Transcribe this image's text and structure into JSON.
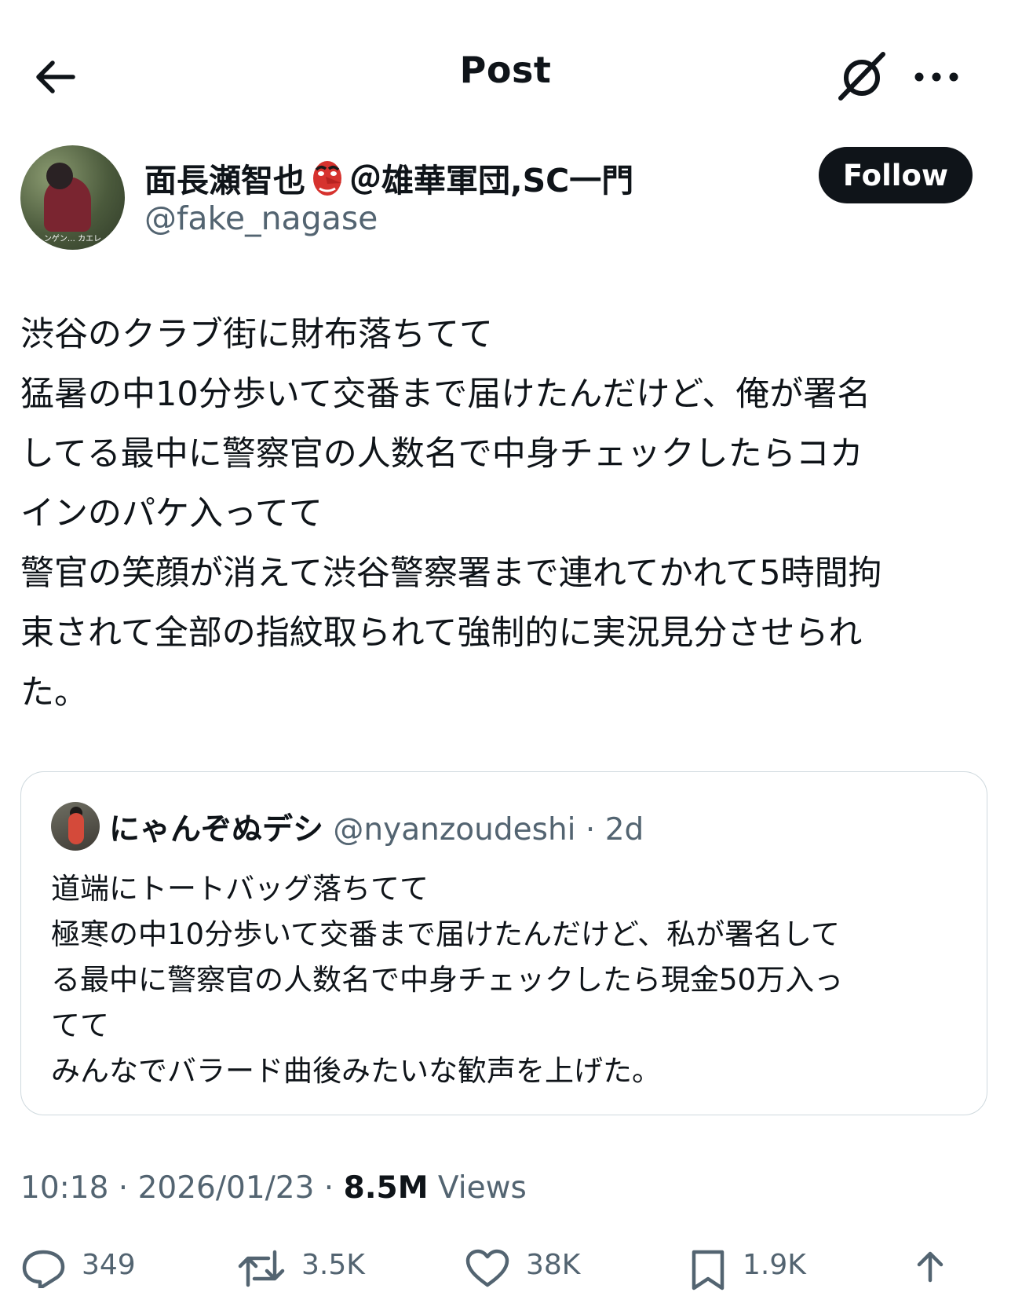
{
  "header": {
    "title": "Post"
  },
  "author": {
    "display_name": "面長瀬智也",
    "display_name_suffix": "＠雄華軍団,SC一門",
    "handle": "@fake_nagase",
    "avatar_caption": "ンゲン… カエレ"
  },
  "follow_label": "Follow",
  "post": {
    "lines": [
      "渋谷のクラブ街に財布落ちてて",
      "猛暑の中10分歩いて交番まで届けたんだけど、俺が署名",
      "してる最中に警察官の人数名で中身チェックしたらコカ",
      "インのパケ入ってて",
      "警官の笑顔が消えて渋谷警察署まで連れてかれて5時間拘",
      "束されて全部の指紋取られて強制的に実況見分させられ",
      "た。"
    ]
  },
  "quote": {
    "name": "にゃんぞぬデシ",
    "handle": "@nyanzoudeshi",
    "separator": " · ",
    "time": "2d",
    "lines": [
      "道端にトートバッグ落ちてて",
      "極寒の中10分歩いて交番まで届けたんだけど、私が署名して",
      "る最中に警察官の人数名で中身チェックしたら現金50万入っ",
      "てて",
      "みんなでバラード曲後みたいな歓声を上げた。"
    ]
  },
  "meta": {
    "time": "10:18",
    "sep1": " · ",
    "date": "2026/01/23",
    "sep2": " · ",
    "views_count": "8.5M",
    "views_label": " Views"
  },
  "actions": {
    "replies": "349",
    "reposts": "3.5K",
    "likes": "38K",
    "bookmarks": "1.9K"
  },
  "icons": {
    "back": "arrow-left-icon",
    "grok": "grok-icon",
    "more": "more-icon",
    "reply": "reply-icon",
    "repost": "repost-icon",
    "like": "heart-icon",
    "bookmark": "bookmark-icon",
    "share": "share-icon"
  }
}
